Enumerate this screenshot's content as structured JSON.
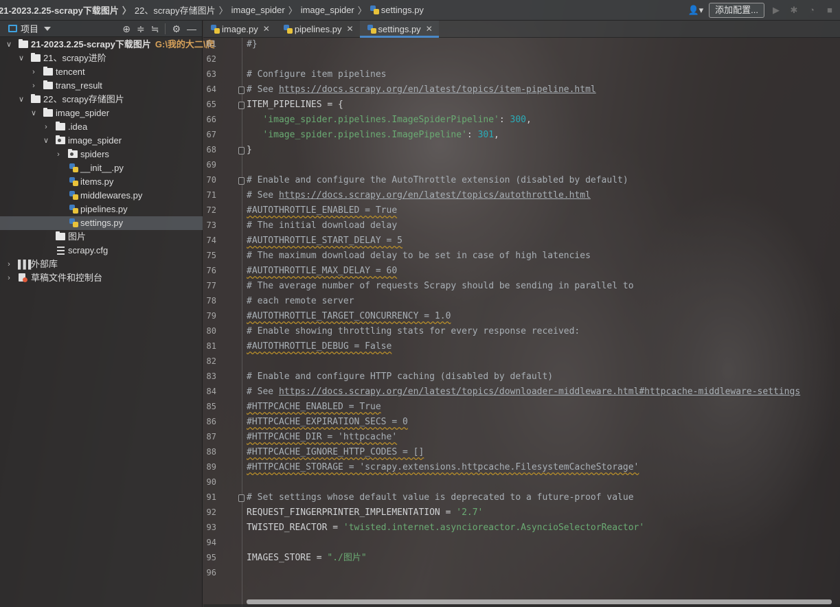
{
  "breadcrumb": {
    "items": [
      "21-2023.2.25-scrapy下载图片",
      "22、scrapy存储图片",
      "image_spider",
      "image_spider",
      "settings.py"
    ]
  },
  "toolbar": {
    "user_icon": "user-icon",
    "add_config_label": "添加配置...",
    "run_icon": "play-icon",
    "debug_icon": "bug-icon",
    "coverage_icon": "coverage-icon",
    "stop_icon": "stop-icon"
  },
  "project_panel": {
    "title": "项目",
    "tools": [
      "crosshair-icon",
      "expand-all-icon",
      "collapse-all-icon",
      "gear-icon",
      "minimize-icon"
    ],
    "tree": [
      {
        "label": "21-2023.2.25-scrapy下载图片",
        "hint": "G:\\我的大二\\爬",
        "type": "folder",
        "expanded": true,
        "bold": true
      },
      {
        "label": "21、scrapy进阶",
        "type": "folder",
        "expanded": true
      },
      {
        "label": "tencent",
        "type": "folder",
        "expanded": false
      },
      {
        "label": "trans_result",
        "type": "folder",
        "expanded": false
      },
      {
        "label": "22、scrapy存储图片",
        "type": "folder",
        "expanded": true
      },
      {
        "label": "image_spider",
        "type": "folder",
        "expanded": true
      },
      {
        "label": ".idea",
        "type": "folder",
        "expanded": false
      },
      {
        "label": "image_spider",
        "type": "package",
        "expanded": true
      },
      {
        "label": "spiders",
        "type": "package",
        "expanded": false
      },
      {
        "label": "__init__.py",
        "type": "py"
      },
      {
        "label": "items.py",
        "type": "py"
      },
      {
        "label": "middlewares.py",
        "type": "py"
      },
      {
        "label": "pipelines.py",
        "type": "py"
      },
      {
        "label": "settings.py",
        "type": "py",
        "selected": true
      },
      {
        "label": "图片",
        "type": "folder"
      },
      {
        "label": "scrapy.cfg",
        "type": "cfg"
      },
      {
        "label": "外部库",
        "type": "library",
        "expanded": false
      },
      {
        "label": "草稿文件和控制台",
        "type": "scratch",
        "expanded": false
      }
    ]
  },
  "editor": {
    "tabs": [
      {
        "label": "image.py",
        "active": false
      },
      {
        "label": "pipelines.py",
        "active": false
      },
      {
        "label": "settings.py",
        "active": true
      }
    ],
    "lines": [
      {
        "n": "61",
        "fold": false,
        "parts": [
          [
            "cm",
            "#}"
          ]
        ]
      },
      {
        "n": "62",
        "fold": false,
        "parts": []
      },
      {
        "n": "63",
        "fold": false,
        "parts": [
          [
            "cm",
            "# Configure item pipelines"
          ]
        ]
      },
      {
        "n": "64",
        "fold": true,
        "parts": [
          [
            "cm",
            "# See "
          ],
          [
            "lk",
            "https://docs.scrapy.org/en/latest/topics/item-pipeline.html"
          ]
        ]
      },
      {
        "n": "65",
        "fold": true,
        "parts": [
          [
            "",
            "ITEM_PIPELINES = {"
          ]
        ]
      },
      {
        "n": "66",
        "fold": false,
        "parts": [
          [
            "",
            "   "
          ],
          [
            "st",
            "'image_spider.pipelines.ImageSpiderPipeline'"
          ],
          [
            "",
            ": "
          ],
          [
            "nm",
            "300"
          ],
          [
            "",
            ","
          ]
        ]
      },
      {
        "n": "67",
        "fold": false,
        "parts": [
          [
            "",
            "   "
          ],
          [
            "st",
            "'image_spider.pipelines.ImagePipeline'"
          ],
          [
            "",
            ": "
          ],
          [
            "nm",
            "301"
          ],
          [
            "",
            ","
          ]
        ]
      },
      {
        "n": "68",
        "fold": true,
        "parts": [
          [
            "",
            "}"
          ]
        ]
      },
      {
        "n": "69",
        "fold": false,
        "parts": []
      },
      {
        "n": "70",
        "fold": true,
        "parts": [
          [
            "cm",
            "# Enable and configure the AutoThrottle extension (disabled by default)"
          ]
        ]
      },
      {
        "n": "71",
        "fold": false,
        "parts": [
          [
            "cm",
            "# See "
          ],
          [
            "lk",
            "https://docs.scrapy.org/en/latest/topics/autothrottle.html"
          ]
        ]
      },
      {
        "n": "72",
        "fold": false,
        "parts": [
          [
            "cm wv",
            "#AUTOTHROTTLE_ENABLED = True"
          ]
        ]
      },
      {
        "n": "73",
        "fold": false,
        "parts": [
          [
            "cm",
            "# The initial download delay"
          ]
        ]
      },
      {
        "n": "74",
        "fold": false,
        "parts": [
          [
            "cm wv",
            "#AUTOTHROTTLE_START_DELAY = 5"
          ]
        ]
      },
      {
        "n": "75",
        "fold": false,
        "parts": [
          [
            "cm",
            "# The maximum download delay to be set in case of high latencies"
          ]
        ]
      },
      {
        "n": "76",
        "fold": false,
        "parts": [
          [
            "cm wv",
            "#AUTOTHROTTLE_MAX_DELAY = 60"
          ]
        ]
      },
      {
        "n": "77",
        "fold": false,
        "parts": [
          [
            "cm",
            "# The average number of requests Scrapy should be sending in parallel to"
          ]
        ]
      },
      {
        "n": "78",
        "fold": false,
        "parts": [
          [
            "cm",
            "# each remote server"
          ]
        ]
      },
      {
        "n": "79",
        "fold": false,
        "parts": [
          [
            "cm wv",
            "#AUTOTHROTTLE_TARGET_CONCURRENCY = 1.0"
          ]
        ]
      },
      {
        "n": "80",
        "fold": false,
        "parts": [
          [
            "cm",
            "# Enable showing throttling stats for every response received:"
          ]
        ]
      },
      {
        "n": "81",
        "fold": false,
        "parts": [
          [
            "cm wv",
            "#AUTOTHROTTLE_DEBUG = False"
          ]
        ]
      },
      {
        "n": "82",
        "fold": false,
        "parts": []
      },
      {
        "n": "83",
        "fold": false,
        "parts": [
          [
            "cm",
            "# Enable and configure HTTP caching (disabled by default)"
          ]
        ]
      },
      {
        "n": "84",
        "fold": false,
        "parts": [
          [
            "cm",
            "# See "
          ],
          [
            "lk",
            "https://docs.scrapy.org/en/latest/topics/downloader-middleware.html#httpcache-middleware-settings"
          ]
        ]
      },
      {
        "n": "85",
        "fold": false,
        "parts": [
          [
            "cm wv",
            "#HTTPCACHE_ENABLED = True"
          ]
        ]
      },
      {
        "n": "86",
        "fold": false,
        "parts": [
          [
            "cm wv",
            "#HTTPCACHE_EXPIRATION_SECS = 0"
          ]
        ]
      },
      {
        "n": "87",
        "fold": false,
        "parts": [
          [
            "cm wv",
            "#HTTPCACHE_DIR = 'httpcache'"
          ]
        ]
      },
      {
        "n": "88",
        "fold": false,
        "parts": [
          [
            "cm wv",
            "#HTTPCACHE_IGNORE_HTTP_CODES = []"
          ]
        ]
      },
      {
        "n": "89",
        "fold": false,
        "parts": [
          [
            "cm wv",
            "#HTTPCACHE_STORAGE = 'scrapy.extensions.httpcache.FilesystemCacheStorage'"
          ]
        ]
      },
      {
        "n": "90",
        "fold": false,
        "parts": []
      },
      {
        "n": "91",
        "fold": true,
        "parts": [
          [
            "cm",
            "# Set settings whose default value is deprecated to a future-proof value"
          ]
        ]
      },
      {
        "n": "92",
        "fold": false,
        "parts": [
          [
            "",
            "REQUEST_FINGERPRINTER_IMPLEMENTATION = "
          ],
          [
            "st",
            "'2.7'"
          ]
        ]
      },
      {
        "n": "93",
        "fold": false,
        "parts": [
          [
            "",
            "TWISTED_REACTOR = "
          ],
          [
            "st",
            "'twisted.internet.asyncioreactor.AsyncioSelectorReactor'"
          ]
        ]
      },
      {
        "n": "94",
        "fold": false,
        "parts": []
      },
      {
        "n": "95",
        "fold": false,
        "parts": [
          [
            "",
            "IMAGES_STORE = "
          ],
          [
            "st",
            "\"./图片\""
          ]
        ]
      },
      {
        "n": "96",
        "fold": false,
        "parts": []
      }
    ]
  }
}
